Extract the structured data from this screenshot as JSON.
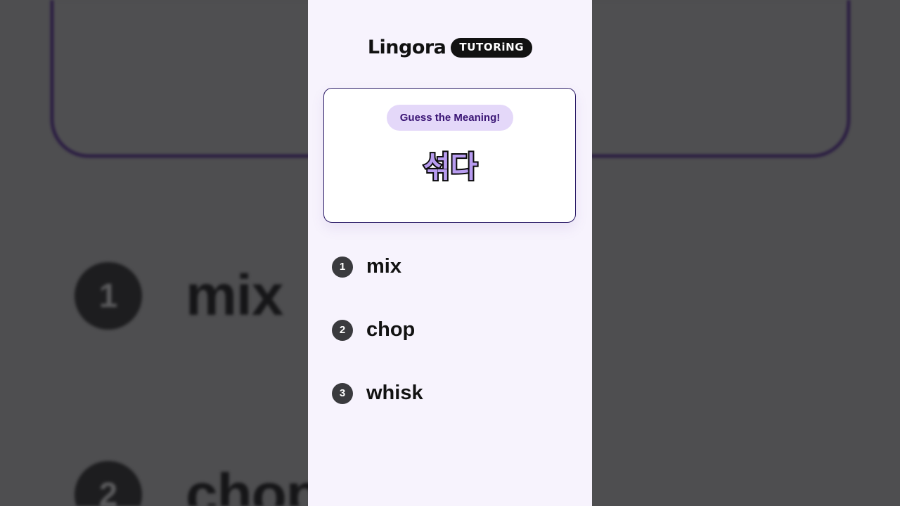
{
  "brand": {
    "name": "Lingora",
    "tag": "TUTORiNG"
  },
  "quiz": {
    "prompt": "Guess the Meaning!",
    "word": "섞다",
    "options": [
      {
        "number": "1",
        "label": "mix"
      },
      {
        "number": "2",
        "label": "chop"
      },
      {
        "number": "3",
        "label": "whisk"
      }
    ]
  }
}
